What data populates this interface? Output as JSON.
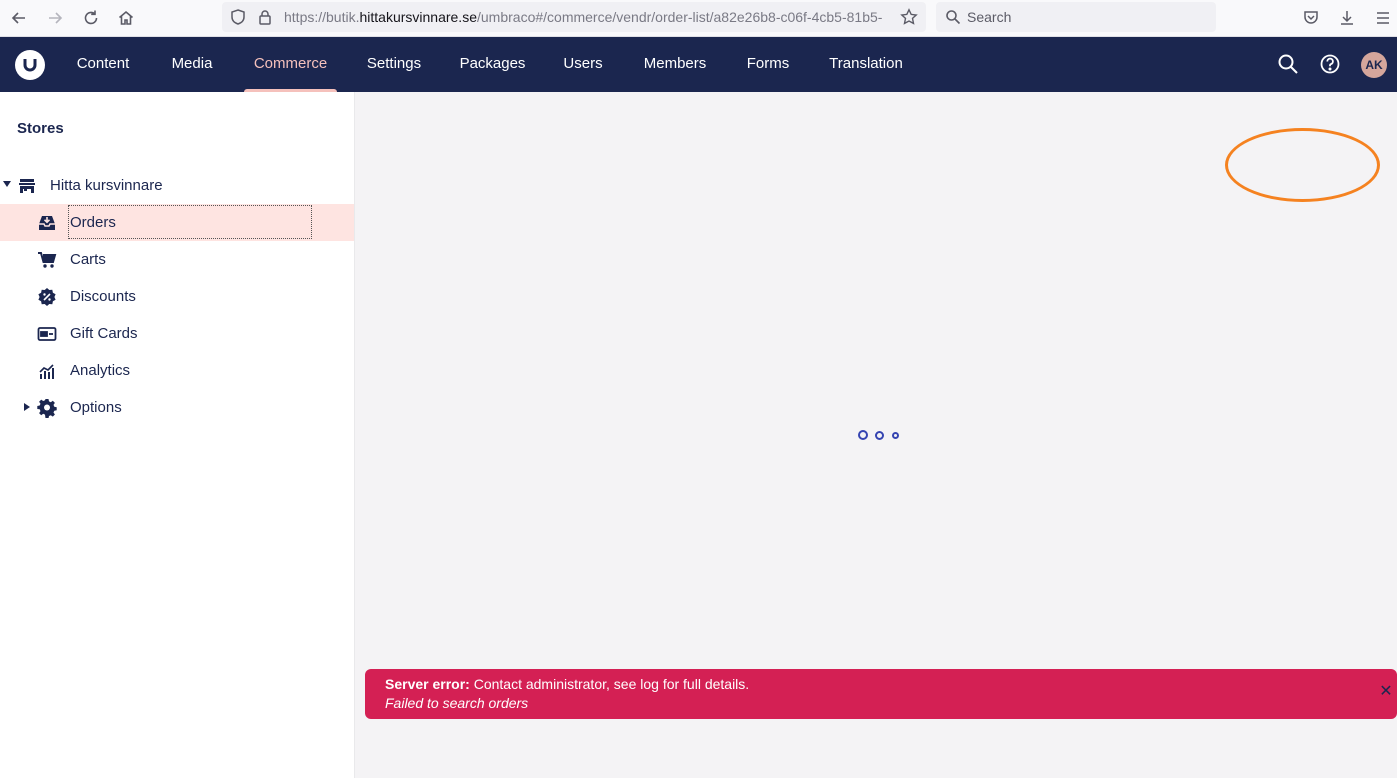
{
  "browser": {
    "url_prefix": "https://butik.",
    "url_host": "hittakursvinnare.se",
    "url_path": "/umbraco#/commerce/vendr/order-list/a82e26b8-c06f-4cb5-81b5-",
    "search_placeholder": "Search"
  },
  "header": {
    "sections": [
      "Content",
      "Media",
      "Commerce",
      "Settings",
      "Packages",
      "Users",
      "Members",
      "Forms",
      "Translation"
    ],
    "active_section": "Commerce",
    "avatar_initials": "AK"
  },
  "sidebar": {
    "title": "Stores",
    "store_name": "Hitta kursvinnare",
    "items": [
      {
        "label": "Orders",
        "icon": "inbox-download-icon",
        "selected": true
      },
      {
        "label": "Carts",
        "icon": "cart-icon"
      },
      {
        "label": "Discounts",
        "icon": "discount-badge-icon"
      },
      {
        "label": "Gift Cards",
        "icon": "gift-card-icon"
      },
      {
        "label": "Analytics",
        "icon": "analytics-chart-icon"
      },
      {
        "label": "Options",
        "icon": "gear-icon",
        "expandable": true
      }
    ]
  },
  "error": {
    "title": "Server error:",
    "message": " Contact administrator, see log for full details.",
    "detail": "Failed to search orders"
  },
  "colors": {
    "header_bg": "#1b264f",
    "active_section": "#f5c1bc",
    "selected_row": "#fee4e1",
    "error_bg": "#d42054",
    "annotation": "#f58220"
  }
}
